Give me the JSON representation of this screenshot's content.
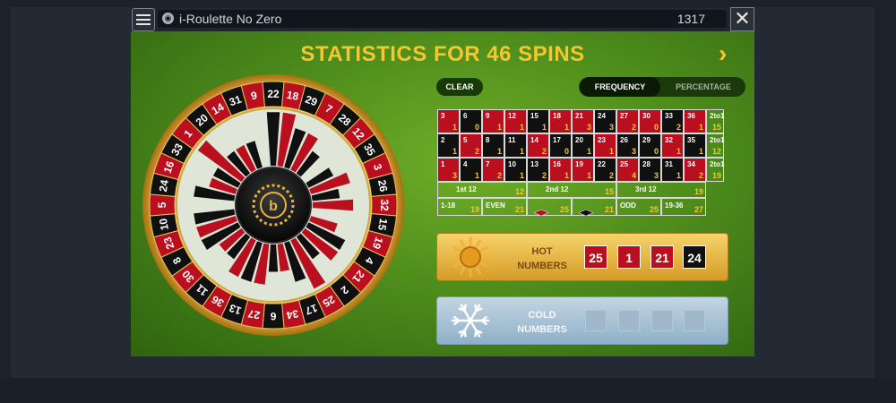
{
  "app": {
    "title": "i-Roulette No Zero",
    "counter": "1317",
    "title_icon": "game-logo-icon",
    "menu_icon": "hamburger-icon",
    "close_label": "✕"
  },
  "stats": {
    "heading": "STATISTICS FOR 46 SPINS",
    "next_arrow": "›"
  },
  "controls": {
    "clear": "CLEAR",
    "frequency": "FREQUENCY",
    "percentage": "PERCENTAGE",
    "active_mode": "FREQUENCY"
  },
  "colors": {
    "red": "#b90f1e",
    "black": "#101010",
    "felt_green": "#4f8d1c",
    "gold": "#f6c62e"
  },
  "wheel": {
    "sequence": [
      22,
      18,
      29,
      7,
      28,
      12,
      35,
      3,
      26,
      32,
      15,
      19,
      4,
      21,
      2,
      25,
      17,
      34,
      6,
      27,
      13,
      36,
      11,
      30,
      8,
      23,
      10,
      5,
      24,
      16,
      33,
      1,
      20,
      14,
      31,
      9
    ],
    "red_numbers": [
      1,
      3,
      5,
      7,
      9,
      12,
      14,
      16,
      18,
      19,
      21,
      23,
      25,
      27,
      30,
      32,
      34,
      36
    ],
    "frequency_bars": [
      3,
      3,
      2,
      2,
      1,
      0,
      1,
      2,
      1,
      2,
      0,
      1,
      2,
      2,
      1,
      3,
      2,
      1,
      1,
      2,
      2,
      2,
      1,
      1,
      2,
      2,
      2,
      0,
      2,
      1,
      1,
      3,
      1,
      1,
      1,
      0
    ],
    "center_icon": "roulette-logo-icon"
  },
  "table": {
    "grid": [
      [
        {
          "n": "3",
          "c": "1"
        },
        {
          "n": "6",
          "c": "0"
        },
        {
          "n": "9",
          "c": "1"
        },
        {
          "n": "12",
          "c": "1"
        },
        {
          "n": "15",
          "c": "1"
        },
        {
          "n": "18",
          "c": "1"
        },
        {
          "n": "21",
          "c": "3"
        },
        {
          "n": "24",
          "c": "3"
        },
        {
          "n": "27",
          "c": "2"
        },
        {
          "n": "30",
          "c": "0"
        },
        {
          "n": "33",
          "c": "2"
        },
        {
          "n": "36",
          "c": "1"
        },
        {
          "n": "2to1",
          "c": "15"
        }
      ],
      [
        {
          "n": "2",
          "c": "1"
        },
        {
          "n": "5",
          "c": "2"
        },
        {
          "n": "8",
          "c": "1"
        },
        {
          "n": "11",
          "c": "1"
        },
        {
          "n": "14",
          "c": "2"
        },
        {
          "n": "17",
          "c": "0"
        },
        {
          "n": "20",
          "c": "1"
        },
        {
          "n": "23",
          "c": "1"
        },
        {
          "n": "26",
          "c": "3"
        },
        {
          "n": "29",
          "c": "0"
        },
        {
          "n": "32",
          "c": "1"
        },
        {
          "n": "35",
          "c": "1"
        },
        {
          "n": "2to1",
          "c": "12"
        }
      ],
      [
        {
          "n": "1",
          "c": "3"
        },
        {
          "n": "4",
          "c": "1"
        },
        {
          "n": "7",
          "c": "2"
        },
        {
          "n": "10",
          "c": "1"
        },
        {
          "n": "13",
          "c": "2"
        },
        {
          "n": "16",
          "c": "1"
        },
        {
          "n": "19",
          "c": "1"
        },
        {
          "n": "22",
          "c": "2"
        },
        {
          "n": "25",
          "c": "4"
        },
        {
          "n": "28",
          "c": "3"
        },
        {
          "n": "31",
          "c": "1"
        },
        {
          "n": "34",
          "c": "2"
        },
        {
          "n": "2to1",
          "c": "19"
        }
      ]
    ],
    "dozens": [
      {
        "label": "1st 12",
        "c": "12"
      },
      {
        "label": "2nd 12",
        "c": "15"
      },
      {
        "label": "3rd 12",
        "c": "19"
      }
    ],
    "outside": [
      {
        "label": "1-18",
        "c": "19"
      },
      {
        "label": "EVEN",
        "c": "21"
      },
      {
        "label": "",
        "c": "25",
        "diamond": "red-diamond-icon"
      },
      {
        "label": "",
        "c": "21",
        "diamond": "black-diamond-icon"
      },
      {
        "label": "ODD",
        "c": "25"
      },
      {
        "label": "19-36",
        "c": "27"
      }
    ]
  },
  "hot": {
    "label_line1": "HOT",
    "label_line2": "NUMBERS",
    "icon": "sun-icon",
    "numbers": [
      "25",
      "1",
      "21",
      "24"
    ]
  },
  "cold": {
    "label_line1": "COLD",
    "label_line2": "NUMBERS",
    "icon": "snowflake-icon",
    "numbers": [
      "",
      "",
      "",
      ""
    ]
  }
}
